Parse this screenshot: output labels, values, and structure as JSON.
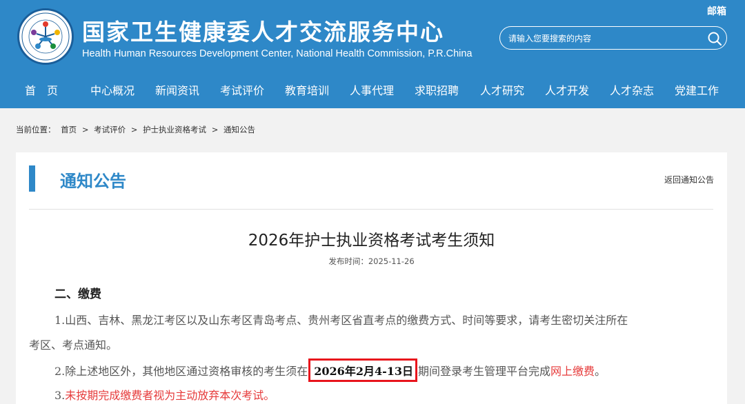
{
  "header": {
    "title_cn": "国家卫生健康委人才交流服务中心",
    "title_en": "Health Human Resources Development Center, National Health Commission, P.R.China",
    "mail_label": "邮箱",
    "search_placeholder": "请输入您要搜索的内容"
  },
  "nav": {
    "items": [
      "首　页",
      "中心概况",
      "新闻资讯",
      "考试评价",
      "教育培训",
      "人事代理",
      "求职招聘",
      "人才研究",
      "人才开发",
      "人才杂志",
      "党建工作"
    ]
  },
  "breadcrumb": {
    "prefix": "当前位置：",
    "items": [
      "首页",
      "考试评价",
      "护士执业资格考试",
      "通知公告"
    ],
    "separator": ">"
  },
  "section": {
    "title": "通知公告",
    "back_label": "返回通知公告"
  },
  "article": {
    "title": "2026年护士执业资格考试考生须知",
    "publish_label": "发布时间：",
    "publish_date": "2025-11-26",
    "heading": "二、缴费",
    "p1_line1": "1.山西、吉林、黑龙江考区以及山东考区青岛考点、贵州考区省直考点的缴费方式、时间等要求，请考生密切关注所在",
    "p1_line2": "考区、考点通知。",
    "p2_before": "2.除上述地区外，其他地区通过资格审核的考生须在",
    "p2_highlight": "2026年2月4-13日",
    "p2_middle": "期间登录考生管理平台完成",
    "p2_red": "网上缴费",
    "p2_end": "。",
    "p3_num": "3.",
    "p3_red": "未按期完成缴费者视为主动放弃本次考试。"
  },
  "colors": {
    "header_blue": "#2e88c8",
    "highlight_red": "#e8141c",
    "text_red": "#e63b3b"
  }
}
